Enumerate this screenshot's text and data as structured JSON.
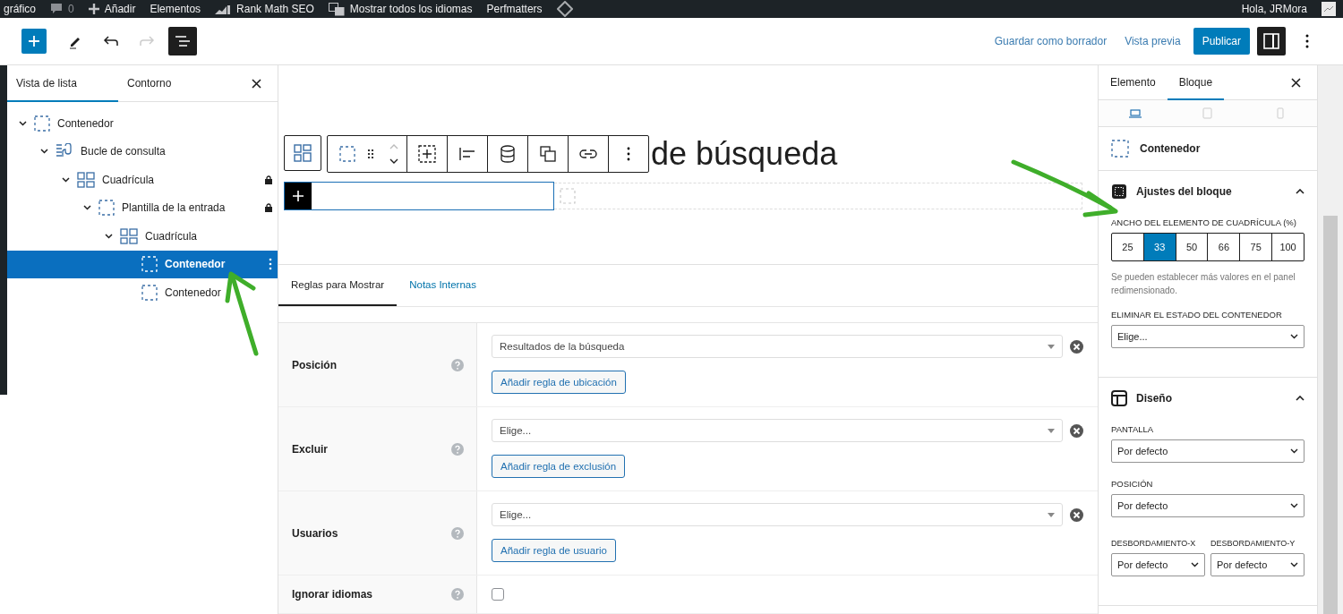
{
  "admin_bar": {
    "items": [
      {
        "kind": "text",
        "label": "gráfico"
      },
      {
        "kind": "comments",
        "label": "0"
      },
      {
        "kind": "add",
        "label": "Añadir"
      },
      {
        "kind": "text",
        "label": "Elementos"
      },
      {
        "kind": "chart",
        "label": "Rank Math SEO"
      },
      {
        "kind": "translate",
        "label": "Mostrar todos los idiomas"
      },
      {
        "kind": "text",
        "label": "Perfmatters"
      },
      {
        "kind": "diamond"
      }
    ],
    "greeting": "Hola, JRMora"
  },
  "header": {
    "undo_disabled": false,
    "redo_disabled": true,
    "save_draft": "Guardar como borrador",
    "preview": "Vista previa",
    "publish": "Publicar"
  },
  "list_panel": {
    "tabs": [
      {
        "label": "Vista de lista",
        "selected": true
      },
      {
        "label": "Contorno",
        "selected": false
      }
    ],
    "tree": [
      {
        "label": "Contenedor",
        "kind": "container",
        "expanded": true,
        "locked": false,
        "selected": false,
        "children": [
          {
            "label": "Bucle de consulta",
            "kind": "query-loop",
            "expanded": true,
            "locked": false,
            "selected": false,
            "children": [
              {
                "label": "Cuadrícula",
                "kind": "grid",
                "expanded": true,
                "locked": true,
                "selected": false,
                "children": [
                  {
                    "label": "Plantilla de la entrada",
                    "kind": "container",
                    "expanded": true,
                    "locked": true,
                    "selected": false,
                    "children": [
                      {
                        "label": "Cuadrícula",
                        "kind": "grid",
                        "expanded": true,
                        "locked": false,
                        "selected": false,
                        "children": [
                          {
                            "label": "Contenedor",
                            "kind": "container",
                            "expanded": false,
                            "locked": false,
                            "selected": true
                          },
                          {
                            "label": "Contenedor",
                            "kind": "container",
                            "expanded": false,
                            "locked": false,
                            "selected": false
                          }
                        ]
                      }
                    ]
                  }
                ]
              }
            ]
          }
        ]
      }
    ]
  },
  "canvas": {
    "heading": "de búsqueda",
    "meta_tabs": [
      {
        "label": "Reglas para Mostrar",
        "selected": true
      },
      {
        "label": "Notas Internas",
        "selected": false
      }
    ],
    "rules": [
      {
        "kind": "select",
        "label": "Posición",
        "value": "Resultados de la búsqueda",
        "button": "Añadir regla de ubicación"
      },
      {
        "kind": "select",
        "label": "Excluir",
        "value": "Elige...",
        "button": "Añadir regla de exclusión"
      },
      {
        "kind": "select",
        "label": "Usuarios",
        "value": "Elige...",
        "button": "Añadir regla de usuario"
      },
      {
        "kind": "checkbox",
        "label": "Ignorar idiomas",
        "checked": false
      }
    ]
  },
  "sidebar": {
    "tabs": [
      {
        "label": "Elemento",
        "selected": false
      },
      {
        "label": "Bloque",
        "selected": true
      }
    ],
    "devices": [
      {
        "kind": "desktop",
        "selected": true
      },
      {
        "kind": "tablet",
        "selected": false
      },
      {
        "kind": "mobile",
        "selected": false
      }
    ],
    "block_name": "Contenedor",
    "panels": [
      {
        "title": "Ajustes del bloque",
        "kind": "block",
        "expanded": true,
        "fields": [
          {
            "kind": "buttons",
            "label": "ANCHO DEL ELEMENTO DE CUADRÍCULA (%)",
            "options": [
              {
                "label": "25",
                "selected": false
              },
              {
                "label": "33",
                "selected": true
              },
              {
                "label": "50",
                "selected": false
              },
              {
                "label": "66",
                "selected": false
              },
              {
                "label": "75",
                "selected": false
              },
              {
                "label": "100",
                "selected": false
              }
            ],
            "help": "Se pueden establecer más valores en el panel redimensionado."
          },
          {
            "kind": "select",
            "label": "ELIMINAR EL ESTADO DEL CONTENEDOR",
            "value": "Elige..."
          }
        ]
      },
      {
        "title": "Diseño",
        "kind": "layout",
        "expanded": true,
        "fields": [
          {
            "kind": "select",
            "label": "PANTALLA",
            "value": "Por defecto"
          },
          {
            "kind": "select",
            "label": "POSICIÓN",
            "value": "Por defecto"
          },
          {
            "kind": "pair",
            "items": [
              {
                "label": "DESBORDAMIENTO-X",
                "value": "Por defecto"
              },
              {
                "label": "DESBORDAMIENTO-Y",
                "value": "Por defecto"
              }
            ]
          }
        ]
      }
    ]
  }
}
